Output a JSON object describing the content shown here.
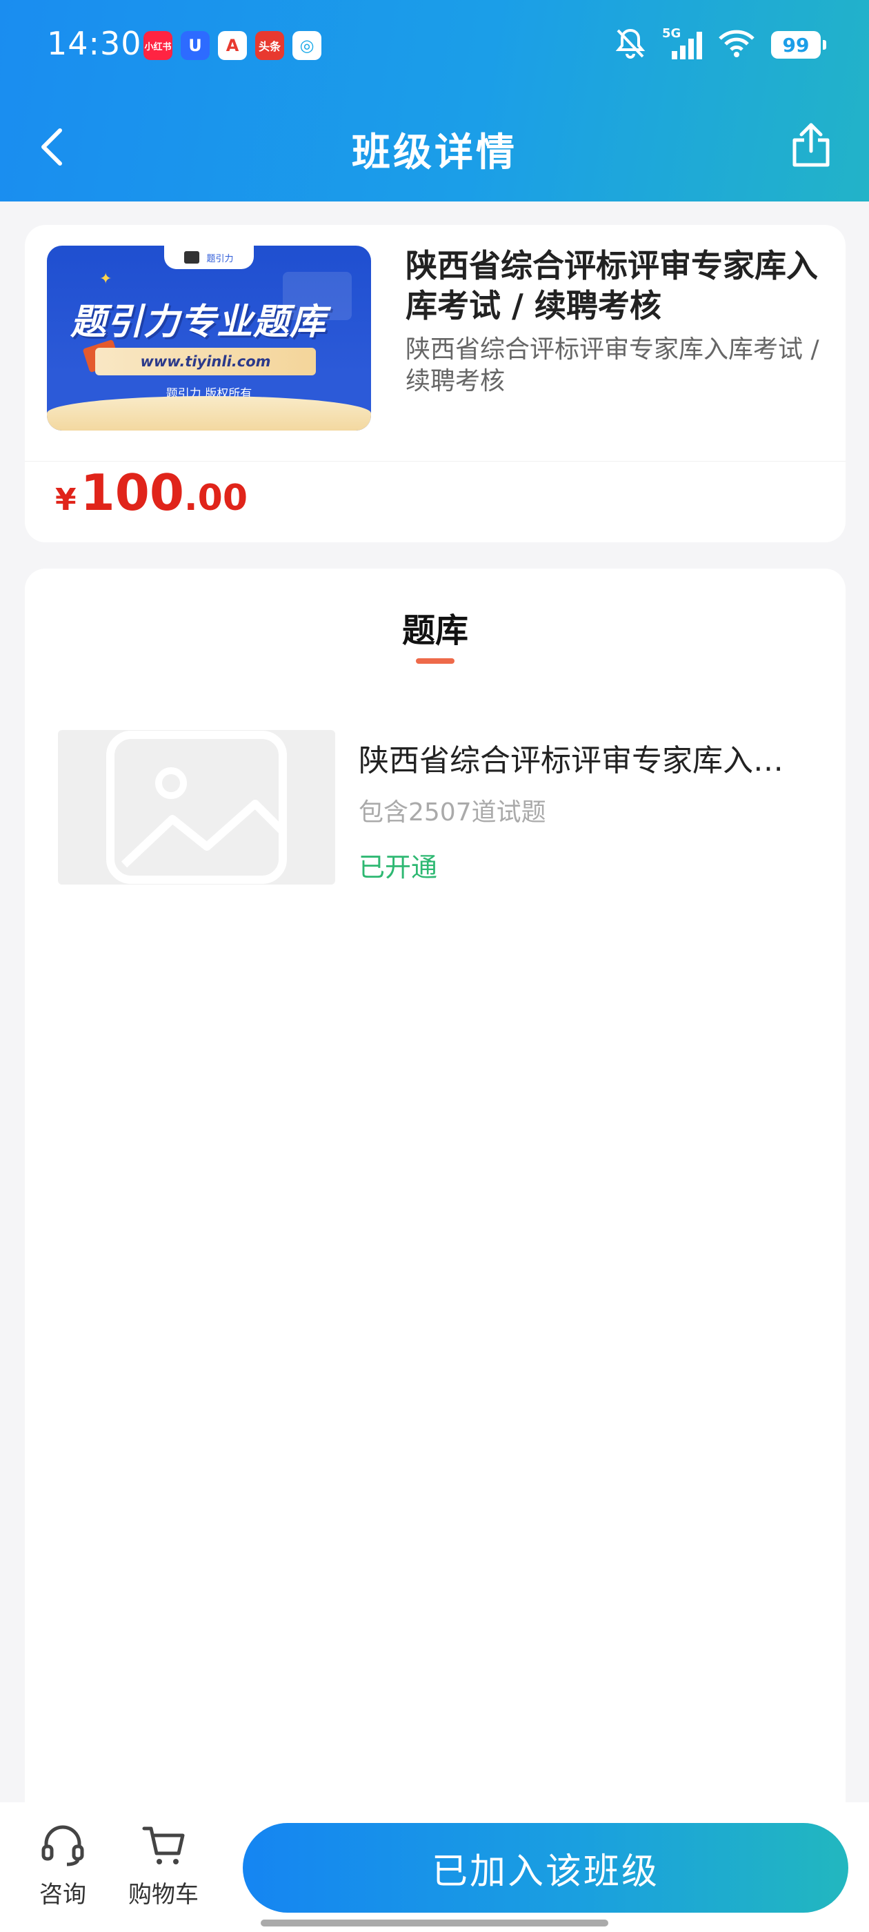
{
  "status_bar": {
    "time": "14:30",
    "app_badges": [
      {
        "label": "小红书",
        "color": "#ff2442"
      },
      {
        "label": "U",
        "color": "#2d6bff"
      },
      {
        "label": "A",
        "color": "#e8392f"
      },
      {
        "label": "头条",
        "color": "#e8392f"
      },
      {
        "label": "◎",
        "color": "#17a9e8"
      }
    ],
    "network": "5G",
    "battery": "99"
  },
  "nav": {
    "title": "班级详情"
  },
  "course": {
    "banner": {
      "tab_label": "题引力",
      "headline": "题引力专业题库",
      "url": "www.tiyinli.com",
      "copyright": "题引力 版权所有"
    },
    "title": "陕西省综合评标评审专家库入库考试 / 续聘考核",
    "subtitle": "陕西省综合评标评审专家库入库考试 / 续聘考核",
    "price_symbol": "¥",
    "price_int": "100",
    "price_dec": ".00"
  },
  "question_bank": {
    "section_title": "题库",
    "items": [
      {
        "name": "陕西省综合评标评审专家库入库考试 / 续聘考核",
        "count": "包含2507道试题",
        "status": "已开通"
      }
    ]
  },
  "bottom": {
    "consult_label": "咨询",
    "cart_label": "购物车",
    "join_label": "已加入该班级"
  },
  "colors": {
    "accent": "#1b9ee8",
    "price": "#e0241a",
    "status_green": "#2eb872",
    "tab_underline": "#ee6a4a"
  }
}
